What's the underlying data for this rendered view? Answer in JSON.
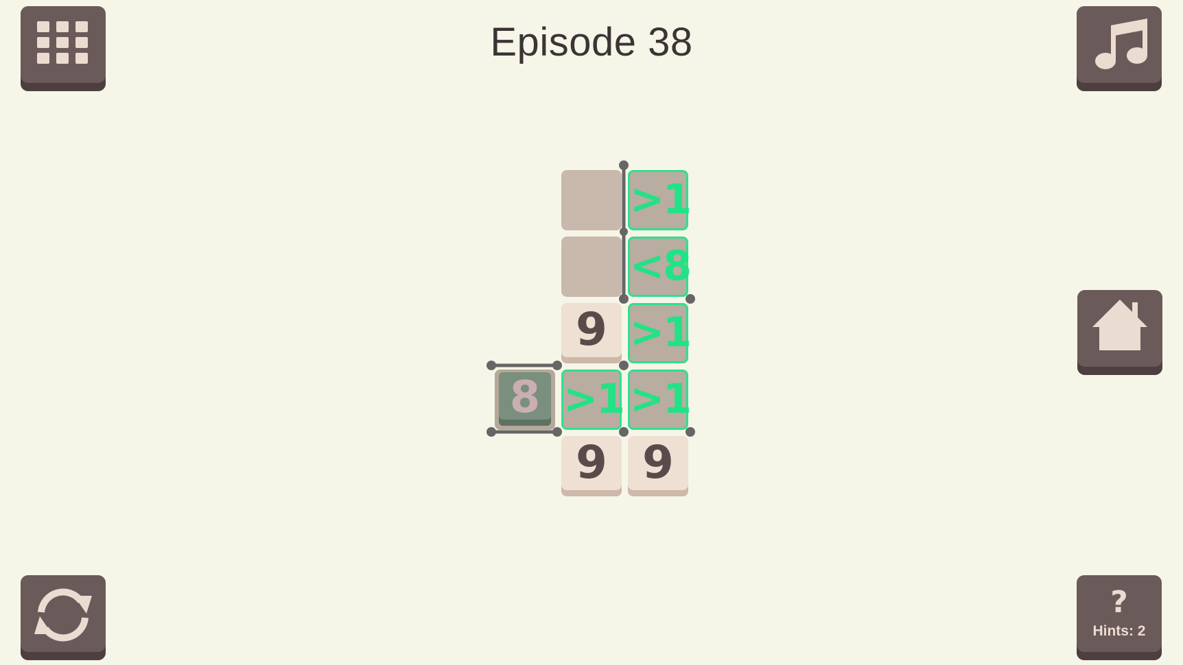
{
  "header": {
    "title": "Episode 38"
  },
  "buttons": {
    "levels_icon": "grid-icon",
    "music_icon": "music-note-icon",
    "home_icon": "home-icon",
    "restart_icon": "refresh-icon",
    "hint_symbol": "?",
    "hint_label": "Hints: 2"
  },
  "colors": {
    "background": "#f6f6e8",
    "button": "#6b5a5a",
    "clue_green": "#22e286",
    "tile": "#eee0d2"
  },
  "board": {
    "cells": [
      {
        "row": 0,
        "col": 2,
        "kind": "empty",
        "text": ""
      },
      {
        "row": 0,
        "col": 3,
        "kind": "clue",
        "text": ">1"
      },
      {
        "row": 1,
        "col": 2,
        "kind": "empty",
        "text": ""
      },
      {
        "row": 1,
        "col": 3,
        "kind": "clue",
        "text": "<8"
      },
      {
        "row": 2,
        "col": 2,
        "kind": "num",
        "text": "9"
      },
      {
        "row": 2,
        "col": 3,
        "kind": "clue",
        "text": ">1"
      },
      {
        "row": 3,
        "col": 1,
        "kind": "selected",
        "text": "8"
      },
      {
        "row": 3,
        "col": 2,
        "kind": "clue",
        "text": ">1"
      },
      {
        "row": 3,
        "col": 3,
        "kind": "clue",
        "text": ">1"
      },
      {
        "row": 4,
        "col": 2,
        "kind": "num",
        "text": "9"
      },
      {
        "row": 4,
        "col": 3,
        "kind": "num",
        "text": "9"
      }
    ]
  }
}
